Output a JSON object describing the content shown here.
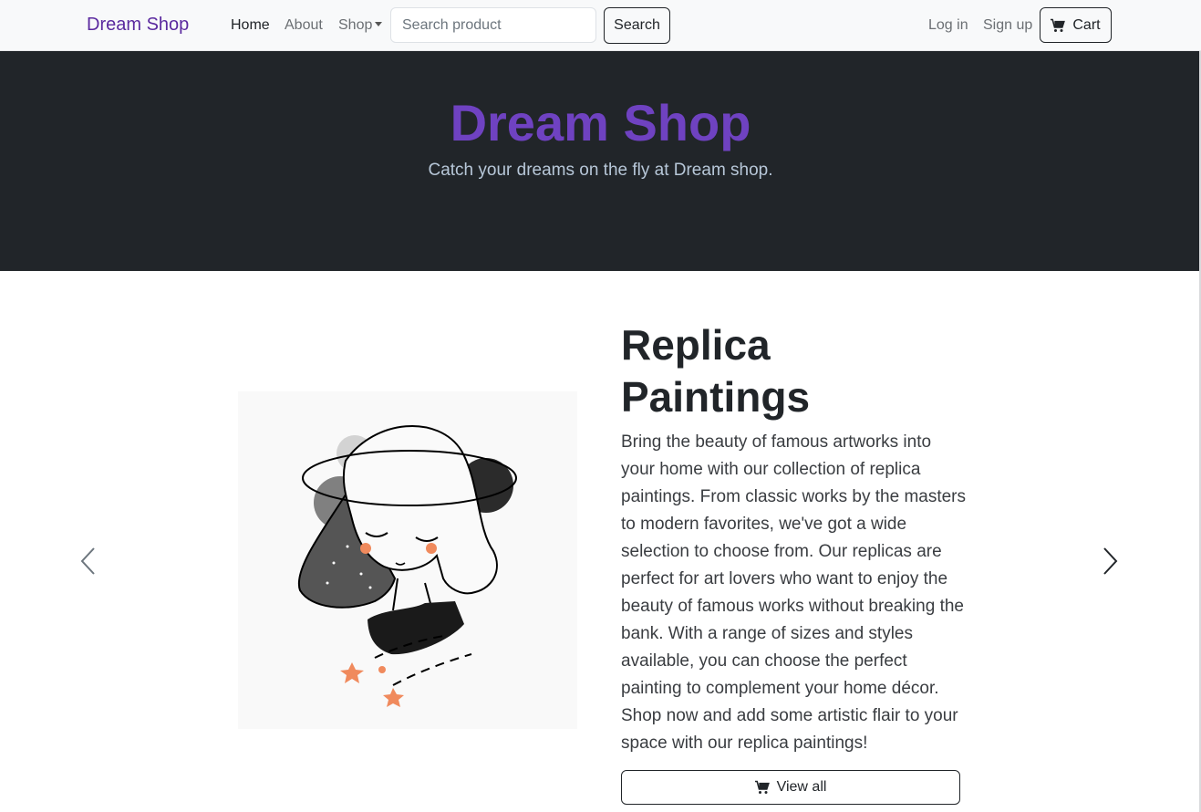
{
  "navbar": {
    "brand": "Dream Shop",
    "links": {
      "home": "Home",
      "about": "About",
      "shop": "Shop"
    },
    "search_placeholder": "Search product",
    "search_button": "Search",
    "login": "Log in",
    "signup": "Sign up",
    "cart": "Cart",
    "cart_icon": "cart-icon"
  },
  "hero": {
    "title": "Dream Shop",
    "subtitle": "Catch your dreams on the fly at Dream shop."
  },
  "carousel": {
    "prev_icon": "chevron-left-icon",
    "next_icon": "chevron-right-icon",
    "slide": {
      "title": "Replica Paintings",
      "description": "Bring the beauty of famous artworks into your home with our collection of replica paintings. From classic works by the masters to modern favorites, we've got a wide selection to choose from. Our replicas are perfect for art lovers who want to enjoy the beauty of famous works without breaking the bank. With a range of sizes and styles available, you can choose the perfect painting to complement your home décor. Shop now and add some artistic flair to your space with our replica paintings!",
      "button": "View all"
    }
  },
  "colors": {
    "brand": "#6f42c1",
    "hero_bg": "#212529",
    "navbar_bg": "#f8f9fa"
  }
}
